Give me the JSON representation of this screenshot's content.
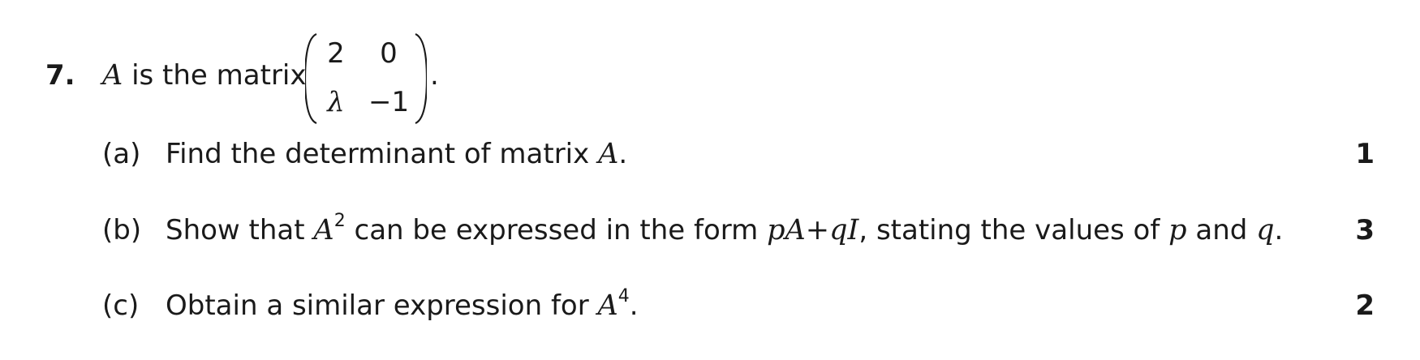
{
  "question": {
    "number": "7.",
    "stem_variable": "A",
    "stem_text": " is the matrix",
    "matrix": {
      "r1c1": "2",
      "r1c2": "0",
      "r2c1": "λ",
      "r2c2": "−1"
    },
    "stem_end": "."
  },
  "parts": [
    {
      "label": "(a)",
      "text_1": "Find the determinant of matrix ",
      "var_1": "A",
      "text_2": ".",
      "marks": "1"
    },
    {
      "label": "(b)",
      "text_1": "Show that ",
      "var_1": "A",
      "sup_1": "2",
      "text_2": " can be expressed in the form ",
      "expr": "pA+qI",
      "text_3": ", stating the values of ",
      "var_p": "p",
      "text_4": " and ",
      "var_q": "q",
      "text_5": ".",
      "marks": "3"
    },
    {
      "label": "(c)",
      "text_1": "Obtain a similar expression for ",
      "var_1": "A",
      "sup_1": "4",
      "text_2": ".",
      "marks": "2"
    }
  ]
}
